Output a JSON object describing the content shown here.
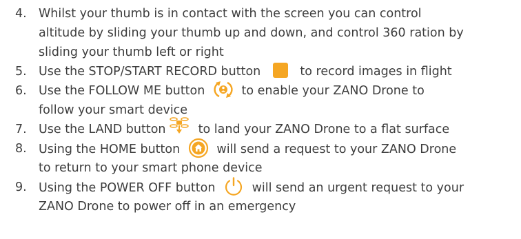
{
  "items": [
    {
      "number": "4.",
      "lines": [
        "Whilst your thumb is in contact with the screen you can control",
        "altitude by sliding your thumb up and down, and control 360 ration by",
        "sliding your thumb left or right"
      ]
    },
    {
      "number": "5.",
      "before": "Use the STOP/START RECORD button",
      "after": "to record images in flight",
      "icon": "record-square-icon"
    },
    {
      "number": "6.",
      "before": "Use the FOLLOW ME button",
      "after": "to enable your ZANO Drone to",
      "line2": "follow your smart device",
      "icon": "follow-me-icon"
    },
    {
      "number": "7.",
      "before": "Use the LAND button",
      "after": "to land your ZANO Drone to a flat surface",
      "icon": "land-drone-icon"
    },
    {
      "number": "8.",
      "before": "Using the HOME button",
      "after": "will send a request to your ZANO Drone",
      "line2": "to return to your smart phone device",
      "icon": "home-icon"
    },
    {
      "number": "9.",
      "before": "Using the POWER OFF button",
      "after": "will send an urgent request to your",
      "line2": "ZANO Drone to power off in an emergency",
      "icon": "power-off-icon"
    }
  ],
  "colors": {
    "text": "#3d3d3d",
    "accent": "#f5a623"
  }
}
